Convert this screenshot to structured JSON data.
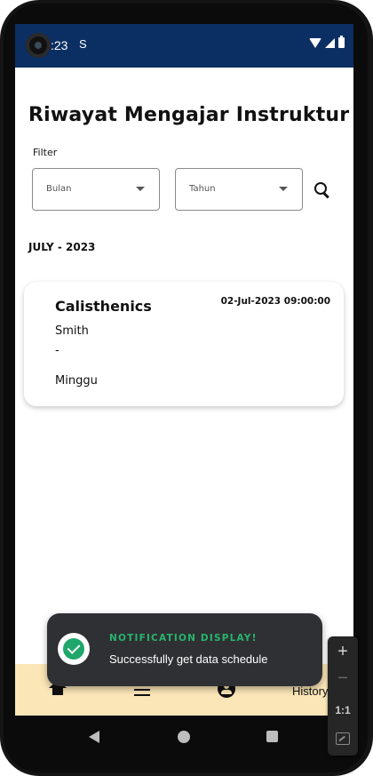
{
  "status_bar": {
    "time": ":23",
    "notification_icon": "S"
  },
  "page": {
    "title": "Riwayat Mengajar Instruktur"
  },
  "filter": {
    "label": "Filter",
    "month_select": {
      "label": "Bulan"
    },
    "year_select": {
      "label": "Tahun"
    },
    "search_icon": "search-icon"
  },
  "history": {
    "group_label": "JULY - 2023",
    "items": [
      {
        "class_name": "Calisthenics",
        "datetime": "02-Jul-2023 09:00:00",
        "instructor": "Smith",
        "separator": "-",
        "day": "Minggu"
      }
    ]
  },
  "bottom_nav": {
    "items": [
      {
        "icon": "home-icon"
      },
      {
        "icon": "menu-icon"
      },
      {
        "icon": "profile-icon"
      },
      {
        "label": "History"
      }
    ]
  },
  "toast": {
    "title": "NOTIFICATION DISPLAY!",
    "message": "Successfully get data schedule",
    "status_color": "#1fa76b"
  },
  "emulator_zoom": {
    "plus": "+",
    "minus": "−",
    "ratio": "1:1"
  },
  "colors": {
    "status_bar": "#0c2f63",
    "bottom_nav": "#fbe6b7",
    "toast_bg": "#2f3033",
    "toast_title": "#27b56f"
  }
}
